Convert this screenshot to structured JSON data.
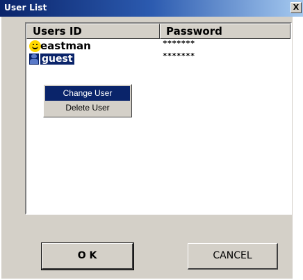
{
  "window": {
    "title": "User List",
    "close_label": "X"
  },
  "list": {
    "columns": [
      "Users ID",
      "Password"
    ],
    "rows": [
      {
        "user": "eastman",
        "password": "*******",
        "icon": "smiley-icon"
      },
      {
        "user": "guest",
        "password": "*******",
        "icon": "user-icon",
        "selected": true
      }
    ]
  },
  "context_menu": {
    "items": [
      "Change User",
      "Delete User"
    ],
    "highlighted": "Change User"
  },
  "buttons": {
    "ok_label": "O K",
    "cancel_label": "CANCEL"
  },
  "colors": {
    "title_start": "#0a246a",
    "title_end": "#a6caf0",
    "face": "#d4d0c8",
    "highlight": "#0a246a"
  }
}
